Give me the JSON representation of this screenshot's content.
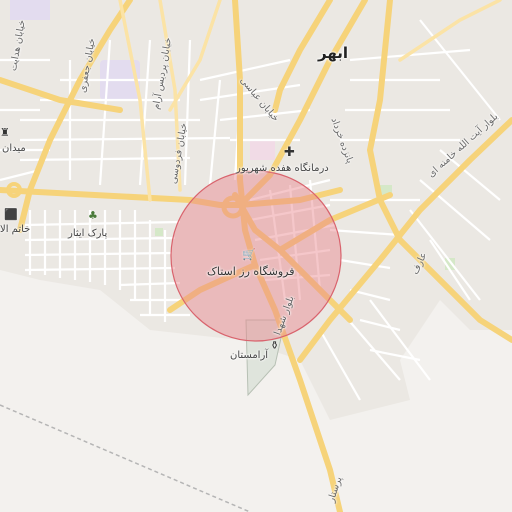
{
  "map": {
    "city_label": "ابهر",
    "highlight_color": "#e8828a",
    "road_color": "#f6d37a",
    "pois": {
      "clinic": "درمانگاه هفده شهریور",
      "store": "فروشگاه رز استاک",
      "cemetery": "آرامستان",
      "park": "پارک ایثار",
      "square": "میدان",
      "khatam": "خاتم الا"
    },
    "streets": {
      "abbasi": "خیابان عباسی",
      "pardis": "خیابان پردیس آرام",
      "ferdowsi": "خیابان فردوسی",
      "jafari": "خیابان جعفری",
      "hedayat": "خیابان هدایت",
      "khordad": "پانزده خرداد",
      "shohada": "بلوار شهدا",
      "khamenei": "بلوار آیت الله خامنه ای",
      "aref": "عارف",
      "parastar": "پرستار"
    }
  }
}
